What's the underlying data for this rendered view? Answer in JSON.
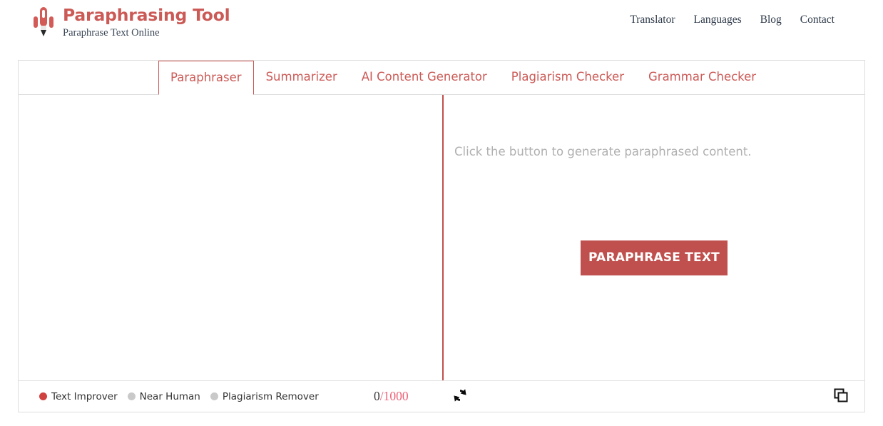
{
  "header": {
    "logo_icon": "rocket-icon",
    "brand_title": "Paraphrasing Tool",
    "brand_subtitle": "Paraphrase Text Online",
    "brand_color": "#cb5a56",
    "nav": [
      {
        "label": "Translator"
      },
      {
        "label": "Languages"
      },
      {
        "label": "Blog"
      },
      {
        "label": "Contact"
      }
    ]
  },
  "tabs": [
    {
      "label": "Paraphraser",
      "active": true
    },
    {
      "label": "Summarizer",
      "active": false
    },
    {
      "label": "AI Content Generator",
      "active": false
    },
    {
      "label": "Plagiarism Checker",
      "active": false
    },
    {
      "label": "Grammar Checker",
      "active": false
    }
  ],
  "editor": {
    "input_value": "",
    "input_placeholder": "",
    "output_placeholder": "Click the button to generate paraphrased content.",
    "cta_label": "PARAPHRASE TEXT",
    "cta_color": "#c0504d",
    "divider_color": "#c0504d"
  },
  "footer": {
    "modes": [
      {
        "label": "Text Improver",
        "selected": true,
        "dot_color": "#d0423f"
      },
      {
        "label": "Near Human",
        "selected": false,
        "dot_color": "#c9c9c9"
      },
      {
        "label": "Plagiarism Remover",
        "selected": false,
        "dot_color": "#c9c9c9"
      }
    ],
    "counter_used": "0",
    "counter_separator": "/",
    "counter_max": "1000",
    "refresh_icon": "refresh-icon",
    "copy_icon": "copy-icon"
  }
}
